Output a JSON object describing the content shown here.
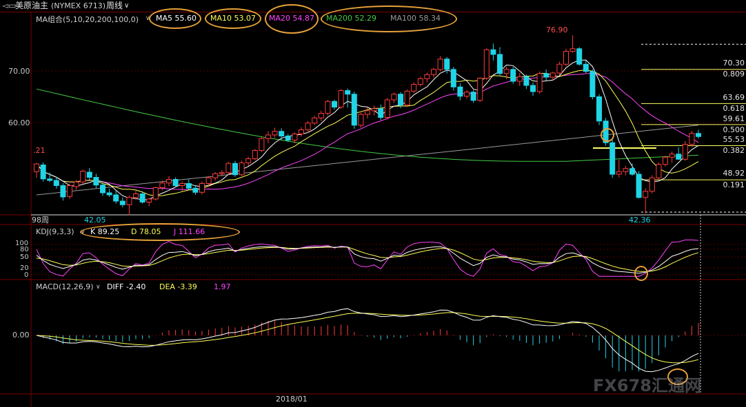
{
  "header": {
    "instrument": "美原油主",
    "code": "(NYMEX 6713)",
    "period": "周线",
    "period_icon": "chevron-down-icon"
  },
  "ma_bar": {
    "group": "MA组合(5,10,20,200,100,0)",
    "items": [
      {
        "text": "MA5 55.60",
        "color": "#ffffff"
      },
      {
        "text": "MA10 53.07",
        "color": "#ffff55"
      },
      {
        "text": "MA20 54.87",
        "color": "#ff44ff"
      },
      {
        "text": "MA200 52.29",
        "color": "#44cc44"
      },
      {
        "text": "MA100 58.34",
        "color": "#9a9a9a"
      }
    ]
  },
  "kdj_bar": {
    "group": "KDJ(9,3,3)",
    "k": "K 89.25",
    "d": "D 78.05",
    "j": "J 111.66",
    "axis": [
      "100",
      "80",
      "50",
      "20",
      "0"
    ]
  },
  "macd_bar": {
    "group": "MACD(12,26,9)",
    "diff": "DIFF -2.40",
    "dea": "DEA -3.39",
    "macd": "1.97",
    "zero": "0.00"
  },
  "price_axis": [
    "70.00",
    "60.00"
  ],
  "price_annotations": {
    "high": "76.90",
    "low_left": "42.05",
    "low_right": "42.36",
    "left_edge": ".21",
    "weeks": "98周"
  },
  "fib_levels": [
    {
      "price": "70.30",
      "ratio": "0.809"
    },
    {
      "price": "63.69",
      "ratio": "0.618"
    },
    {
      "price": "59.61",
      "ratio": "0.500"
    },
    {
      "price": "55.53",
      "ratio": "0.382"
    },
    {
      "price": "48.92",
      "ratio": "0.191"
    }
  ],
  "date_label": "2018/01",
  "watermark": "FX678汇通网",
  "colors": {
    "up": "#ff3c3c",
    "down": "#20d4e6",
    "fib": "#ffff66",
    "highlight": "#e8a23a"
  },
  "chart_data": {
    "type": "candlestick",
    "y_scale": "price (USD/bbl)",
    "ylim": [
      40,
      79
    ],
    "candles": [
      [
        50.5,
        52.2,
        49.3,
        52.0
      ],
      [
        51.8,
        52.3,
        48.6,
        49.1
      ],
      [
        49.1,
        50.3,
        48.5,
        48.8
      ],
      [
        48.8,
        49.5,
        47.2,
        47.8
      ],
      [
        47.8,
        48.3,
        44.9,
        45.6
      ],
      [
        45.7,
        48.2,
        45.2,
        47.8
      ],
      [
        47.6,
        48.9,
        47.0,
        48.5
      ],
      [
        48.5,
        50.9,
        48.1,
        50.6
      ],
      [
        50.4,
        51.2,
        48.9,
        49.4
      ],
      [
        49.4,
        50.1,
        47.3,
        47.9
      ],
      [
        47.9,
        48.4,
        45.8,
        46.4
      ],
      [
        46.4,
        47.2,
        45.6,
        46.0
      ],
      [
        46.0,
        46.9,
        44.3,
        44.8
      ],
      [
        44.8,
        45.5,
        43.6,
        44.1
      ],
      [
        44.1,
        45.9,
        42.05,
        45.5
      ],
      [
        45.5,
        46.8,
        45.0,
        46.2
      ],
      [
        46.2,
        46.7,
        44.3,
        44.6
      ],
      [
        44.6,
        45.4,
        43.8,
        45.2
      ],
      [
        45.2,
        47.6,
        44.9,
        47.4
      ],
      [
        47.4,
        48.8,
        46.9,
        48.3
      ],
      [
        48.3,
        49.6,
        47.7,
        49.0
      ],
      [
        49.0,
        49.4,
        47.5,
        47.8
      ],
      [
        47.8,
        48.6,
        46.7,
        48.2
      ],
      [
        48.2,
        49.0,
        47.0,
        47.3
      ],
      [
        47.3,
        47.9,
        46.0,
        46.5
      ],
      [
        46.5,
        48.6,
        46.1,
        48.2
      ],
      [
        48.2,
        49.6,
        47.6,
        49.3
      ],
      [
        49.3,
        50.4,
        48.8,
        50.1
      ],
      [
        50.1,
        50.8,
        49.6,
        50.3
      ],
      [
        50.3,
        52.4,
        49.9,
        52.1
      ],
      [
        52.1,
        52.6,
        49.5,
        49.9
      ],
      [
        49.9,
        52.6,
        49.6,
        52.2
      ],
      [
        52.2,
        53.4,
        51.6,
        53.0
      ],
      [
        53.0,
        54.9,
        52.7,
        54.6
      ],
      [
        54.6,
        57.2,
        54.3,
        56.9
      ],
      [
        56.9,
        58.3,
        56.0,
        57.6
      ],
      [
        57.6,
        59.0,
        57.1,
        58.3
      ],
      [
        58.3,
        58.9,
        56.6,
        57.4
      ],
      [
        57.4,
        57.8,
        56.2,
        56.6
      ],
      [
        56.6,
        58.1,
        56.0,
        57.8
      ],
      [
        57.8,
        59.1,
        57.3,
        58.6
      ],
      [
        58.6,
        60.3,
        58.0,
        59.9
      ],
      [
        59.9,
        61.3,
        59.5,
        60.9
      ],
      [
        60.9,
        62.3,
        60.3,
        61.8
      ],
      [
        61.8,
        64.4,
        61.4,
        64.1
      ],
      [
        64.1,
        64.4,
        62.5,
        63.0
      ],
      [
        63.0,
        66.5,
        62.7,
        66.2
      ],
      [
        66.2,
        66.6,
        62.9,
        65.5
      ],
      [
        65.5,
        66.0,
        58.8,
        59.5
      ],
      [
        59.5,
        61.9,
        59.0,
        61.6
      ],
      [
        61.6,
        62.9,
        60.8,
        62.3
      ],
      [
        62.3,
        63.3,
        61.4,
        62.7
      ],
      [
        62.7,
        63.5,
        60.5,
        61.0
      ],
      [
        61.0,
        64.8,
        60.6,
        64.4
      ],
      [
        64.4,
        65.8,
        63.8,
        65.5
      ],
      [
        65.5,
        65.9,
        62.8,
        63.4
      ],
      [
        63.4,
        66.4,
        63.0,
        66.1
      ],
      [
        66.1,
        67.8,
        65.7,
        67.4
      ],
      [
        67.4,
        68.9,
        67.0,
        68.5
      ],
      [
        68.5,
        69.7,
        67.8,
        69.3
      ],
      [
        69.3,
        70.6,
        68.7,
        70.3
      ],
      [
        70.3,
        72.9,
        69.9,
        72.3
      ],
      [
        72.3,
        72.7,
        69.5,
        70.3
      ],
      [
        70.3,
        70.8,
        66.2,
        66.9
      ],
      [
        66.9,
        67.6,
        64.3,
        65.1
      ],
      [
        65.1,
        66.3,
        64.6,
        65.9
      ],
      [
        65.9,
        66.3,
        63.8,
        64.3
      ],
      [
        64.3,
        68.8,
        64.0,
        68.6
      ],
      [
        68.6,
        74.4,
        68.2,
        74.1
      ],
      [
        74.1,
        75.3,
        72.0,
        73.2
      ],
      [
        73.2,
        74.6,
        69.0,
        69.5
      ],
      [
        69.5,
        70.8,
        68.4,
        70.3
      ],
      [
        70.3,
        70.8,
        67.5,
        68.0
      ],
      [
        68.0,
        69.6,
        67.1,
        68.9
      ],
      [
        68.9,
        69.3,
        66.5,
        67.2
      ],
      [
        67.2,
        67.8,
        65.2,
        66.0
      ],
      [
        66.0,
        69.9,
        65.6,
        69.5
      ],
      [
        69.5,
        70.3,
        68.1,
        68.8
      ],
      [
        68.8,
        69.8,
        68.2,
        69.6
      ],
      [
        69.6,
        71.8,
        69.2,
        71.3
      ],
      [
        71.3,
        74.3,
        71.0,
        73.8
      ],
      [
        73.8,
        76.9,
        73.5,
        74.3
      ],
      [
        74.3,
        74.6,
        71.0,
        71.3
      ],
      [
        71.3,
        72.0,
        69.6,
        69.9
      ],
      [
        69.9,
        70.3,
        64.5,
        65.0
      ],
      [
        65.0,
        65.5,
        59.5,
        60.3
      ],
      [
        60.3,
        60.9,
        55.5,
        56.1
      ],
      [
        56.1,
        56.7,
        49.3,
        50.0
      ],
      [
        50.0,
        52.8,
        49.4,
        50.5
      ],
      [
        50.5,
        51.6,
        49.8,
        51.1
      ],
      [
        51.1,
        52.1,
        49.7,
        50.0
      ],
      [
        50.0,
        50.6,
        45.3,
        45.5
      ],
      [
        45.5,
        47.3,
        42.36,
        46.7
      ],
      [
        46.7,
        49.8,
        46.3,
        49.3
      ],
      [
        49.3,
        52.3,
        48.9,
        51.9
      ],
      [
        51.9,
        53.6,
        51.5,
        53.3
      ],
      [
        53.3,
        54.4,
        52.2,
        53.9
      ],
      [
        53.9,
        55.2,
        52.8,
        52.9
      ],
      [
        52.9,
        56.4,
        52.6,
        55.8
      ],
      [
        55.8,
        58.4,
        55.3,
        57.9
      ],
      [
        57.9,
        58.6,
        56.9,
        57.3
      ]
    ]
  }
}
